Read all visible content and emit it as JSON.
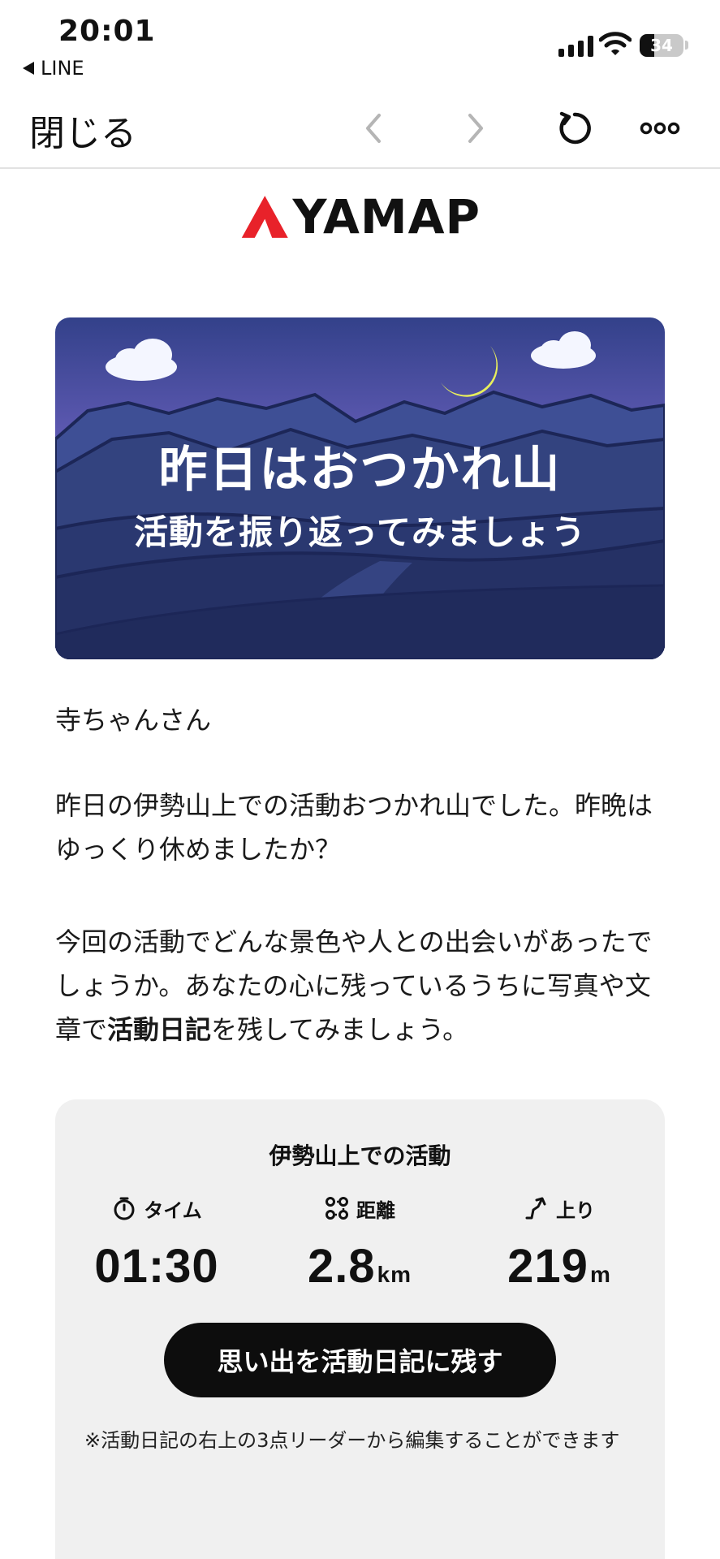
{
  "status_bar": {
    "time": "20:01",
    "back_app": "LINE",
    "battery_level": "34",
    "signal_icon": "signal-bars-icon",
    "wifi_icon": "wifi-icon"
  },
  "nav": {
    "close_label": "閉じる",
    "back_icon": "chevron-left-icon",
    "forward_icon": "chevron-right-icon",
    "reload_icon": "reload-icon",
    "more_icon": "more-dots-icon"
  },
  "logo": {
    "text": "YAMAP",
    "brand_color": "#e8222a"
  },
  "banner": {
    "title": "昨日はおつかれ山",
    "subtitle": "活動を振り返ってみましょう"
  },
  "message": {
    "greeting": "寺ちゃんさん",
    "paragraph1": "昨日の伊勢山上での活動おつかれ山でした。昨晩はゆっくり休めましたか？",
    "paragraph2_before": "今回の活動でどんな景色や人との出会いがあったでしょうか。あなたの心に残っているうちに写真や文章で",
    "paragraph2_bold": "活動日記",
    "paragraph2_after": "を残してみましょう。"
  },
  "stats": {
    "title": "伊勢山上での活動",
    "time_label": "タイム",
    "time_value": "01:30",
    "distance_label": "距離",
    "distance_value": "2.8",
    "distance_unit": "km",
    "ascent_label": "上り",
    "ascent_value": "219",
    "ascent_unit": "m",
    "cta_label": "思い出を活動日記に残す",
    "note": "※活動日記の右上の3点リーダーから編集することができます"
  }
}
